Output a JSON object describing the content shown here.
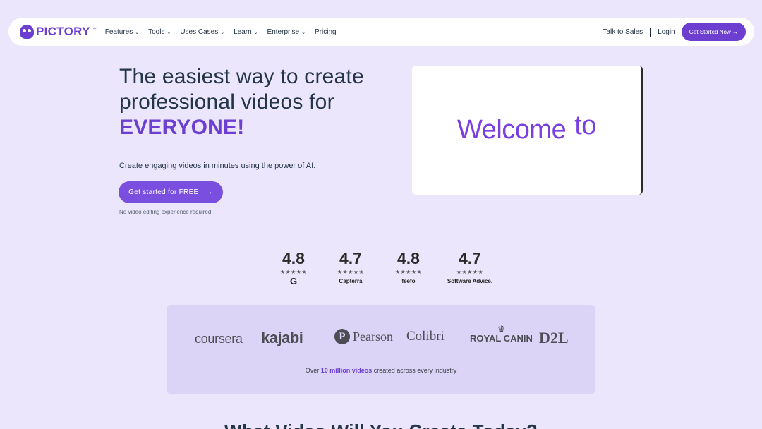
{
  "nav": {
    "logo_text": "PICTORY",
    "logo_tm": "™",
    "items": [
      {
        "label": "Features",
        "dropdown": true
      },
      {
        "label": "Tools",
        "dropdown": true
      },
      {
        "label": "Uses Cases",
        "dropdown": true
      },
      {
        "label": "Learn",
        "dropdown": true
      },
      {
        "label": "Enterprise",
        "dropdown": true
      },
      {
        "label": "Pricing",
        "dropdown": false
      }
    ],
    "talk_to_sales": "Talk to Sales",
    "login": "Login",
    "get_started": "Get Started Now →",
    "chevron": "⌄"
  },
  "hero": {
    "headline_line1": "The easiest way to create",
    "headline_line2": "professional videos for",
    "headline_accent": "EVERYONE!",
    "subline": "Create engaging videos in minutes using the power of AI.",
    "cta_label": "Get started for FREE",
    "cta_arrow": "→",
    "cta_note": "No video editing experience required."
  },
  "video": {
    "word1": "Welcome",
    "word2": "to"
  },
  "ratings": [
    {
      "score": "4.8",
      "stars": "★★★★★",
      "source": "G"
    },
    {
      "score": "4.7",
      "stars": "★★★★★",
      "source": "Capterra"
    },
    {
      "score": "4.8",
      "stars": "★★★★★",
      "source": "feefo"
    },
    {
      "score": "4.7",
      "stars": "★★★★★",
      "source": "Software Advice."
    }
  ],
  "brands": {
    "coursera": "coursera",
    "kajabi": "kajabi",
    "pearson": "Pearson",
    "colibri": "Colibri",
    "royal_canin": "ROYAL CANIN",
    "d2l": "D2L",
    "stat_prefix": "Over ",
    "stat_highlight": "10 million videos",
    "stat_suffix": " created across every industry"
  },
  "next_section": {
    "heading": "What Video Will You Create Today?"
  },
  "colors": {
    "background": "#ebe6fb",
    "brand": "#6c3fd1",
    "cta": "#7a4fe0",
    "brands_panel": "#dcd4f7"
  }
}
